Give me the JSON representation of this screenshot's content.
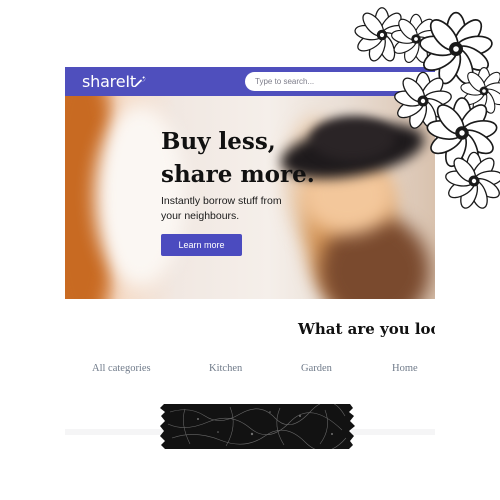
{
  "navbar": {
    "logo_text": "shareIt",
    "logo_icon": "wrench-icon",
    "search_placeholder": "Type to search..."
  },
  "hero": {
    "title_line1": "Buy less,",
    "title_line2": "share more.",
    "subtitle": "Instantly borrow stuff from your neighbours.",
    "button_label": "Learn more"
  },
  "section": {
    "title": "What are you lool"
  },
  "categories": [
    "All categories",
    "Kitchen",
    "Garden",
    "Home"
  ],
  "colors": {
    "brand": "#4f4fbd",
    "button": "#4b4bbf",
    "category_text": "#707b8a"
  },
  "decorations": {
    "stickers": [
      "flower-sticker",
      "black-tape"
    ]
  }
}
